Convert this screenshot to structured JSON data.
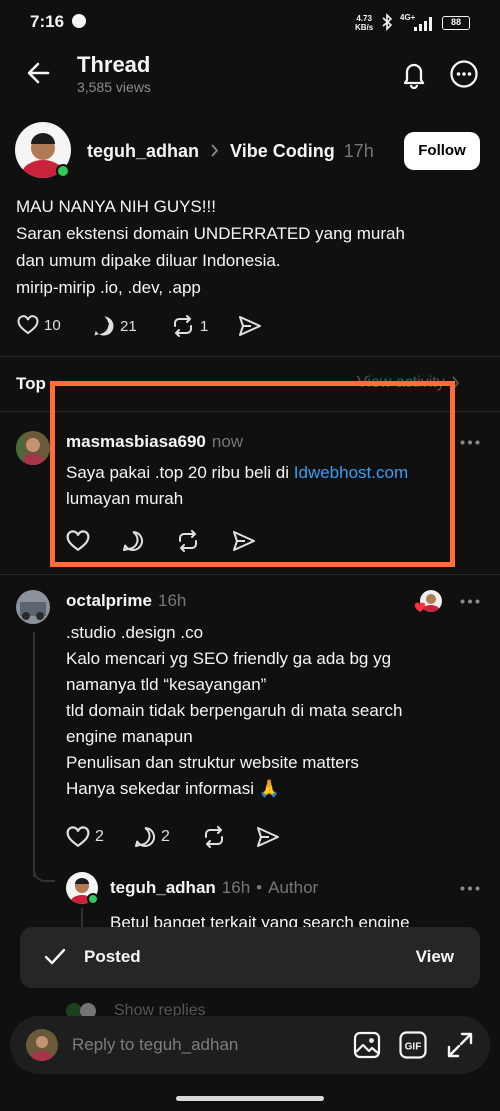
{
  "status_bar": {
    "time": "7:16",
    "speed_value": "4.73",
    "speed_unit": "KB/s",
    "network": "4G+",
    "battery": "88"
  },
  "header": {
    "title": "Thread",
    "views": "3,585 views"
  },
  "post": {
    "author": "teguh_adhan",
    "community": "Vibe Coding",
    "time": "17h",
    "follow_label": "Follow",
    "lines": [
      "MAU NANYA NIH GUYS!!!",
      "Saran ekstensi domain UNDERRATED yang murah",
      "dan umum dipake diluar Indonesia.",
      "mirip-mirip .io, .dev, .app"
    ],
    "likes": "10",
    "replies": "21",
    "reposts": "1"
  },
  "sort": {
    "label": "Top",
    "view_activity": "View activity"
  },
  "comments": [
    {
      "user": "masmasbiasa690",
      "time": "now",
      "text_before_link": "Saya pakai .top 20 ribu beli di ",
      "link": "Idwebhost.com",
      "text_after": "lumayan murah"
    },
    {
      "user": "octalprime",
      "time": "16h",
      "lines": [
        ".studio .design .co",
        "Kalo mencari yg SEO friendly ga ada bg yg",
        "namanya tld “kesayangan”",
        "tld domain tidak berpengaruh di mata search",
        "engine manapun",
        "Penulisan dan struktur website matters",
        "Hanya sekedar informasi 🙏"
      ],
      "likes": "2",
      "replies": "2"
    },
    {
      "user": "teguh_adhan",
      "time": "16h",
      "badge": "Author",
      "text": "Betul banget terkait yang search engine"
    }
  ],
  "show_replies": "Show replies",
  "toast": {
    "label": "Posted",
    "action": "View"
  },
  "reply_bar": {
    "placeholder": "Reply to teguh_adhan"
  },
  "colors": {
    "background": "#101010",
    "highlight": "#ff6e3a",
    "link": "#3d9cf3",
    "online": "#34c759"
  }
}
